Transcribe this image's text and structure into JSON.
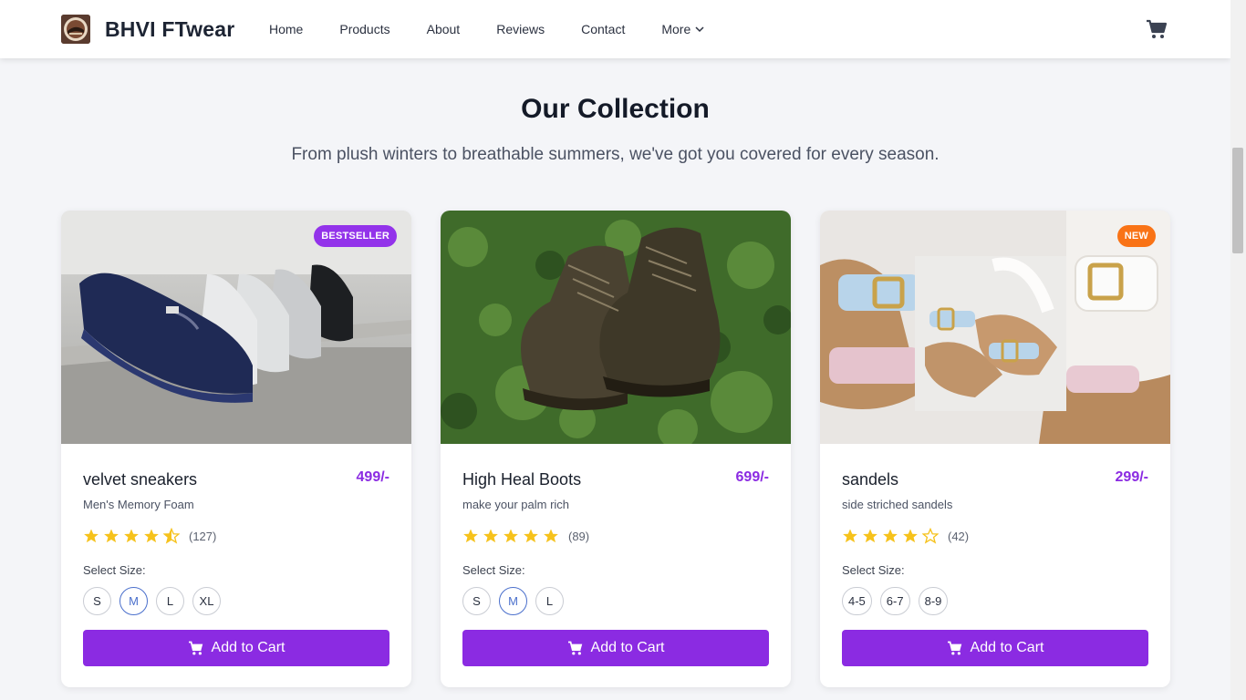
{
  "brand": {
    "name": "BHVI FTwear"
  },
  "nav": {
    "links": [
      "Home",
      "Products",
      "About",
      "Reviews",
      "Contact"
    ],
    "more_label": "More",
    "cart_count": "0"
  },
  "collection": {
    "title": "Our Collection",
    "subtitle": "From plush winters to breathable summers, we've got you covered for every season."
  },
  "products": [
    {
      "name": "velvet sneakers",
      "price": "499/-",
      "description": "Men's Memory Foam",
      "badge": "BESTSELLER",
      "badge_color": "#9333ea",
      "rating": 4.5,
      "reviews": "(127)",
      "size_label": "Select Size:",
      "sizes": [
        "S",
        "M",
        "L",
        "XL"
      ],
      "selected_size": "M",
      "button_label": "Add to Cart"
    },
    {
      "name": "High Heal Boots",
      "price": "699/-",
      "description": "make your palm rich",
      "badge": "",
      "rating": 5,
      "reviews": "(89)",
      "size_label": "Select Size:",
      "sizes": [
        "S",
        "M",
        "L"
      ],
      "selected_size": "M",
      "button_label": "Add to Cart"
    },
    {
      "name": "sandels",
      "price": "299/-",
      "description": "side striched sandels",
      "badge": "NEW",
      "badge_color": "#f97316",
      "rating": 4,
      "reviews": "(42)",
      "size_label": "Select Size:",
      "sizes": [
        "4-5",
        "6-7",
        "8-9"
      ],
      "selected_size": "",
      "button_label": "Add to Cart"
    }
  ],
  "colors": {
    "accent": "#8b2be2",
    "star": "#f6c21c",
    "selected_size_border": "#4a6fcc"
  }
}
